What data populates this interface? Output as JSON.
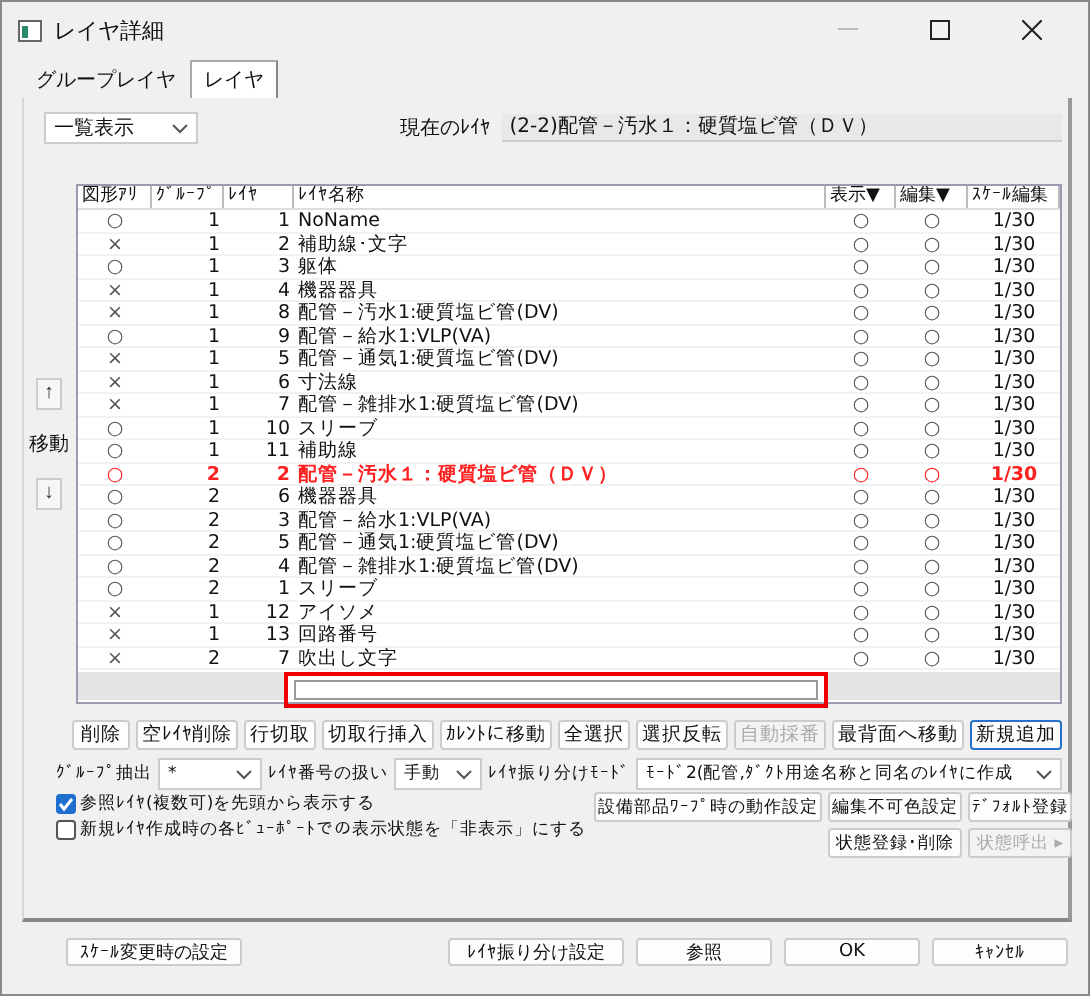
{
  "window": {
    "title": "レイヤ詳細"
  },
  "tabs": [
    {
      "label": "グループレイヤ",
      "selected": false
    },
    {
      "label": "レイヤ",
      "selected": true
    }
  ],
  "view_select": {
    "value": "一覧表示"
  },
  "current_layer": {
    "label": "現在のﾚｲﾔ",
    "value": "(2-2)配管－汚水１：硬質塩ビ管（ＤＶ）"
  },
  "move": {
    "label": "移動",
    "up": "↑",
    "down": "↓"
  },
  "table": {
    "columns": [
      "図形ｱﾘ",
      "ｸﾞﾙｰﾌﾟ",
      "ﾚｲﾔ",
      "ﾚｲﾔ名称",
      "表示▼",
      "編集▼",
      "ｽｹｰﾙ編集"
    ],
    "rows": [
      {
        "shape": "○",
        "group": "1",
        "layer": "1",
        "name": "NoName",
        "show": "○",
        "edit": "○",
        "scale": "1/30",
        "current": false
      },
      {
        "shape": "×",
        "group": "1",
        "layer": "2",
        "name": "補助線･文字",
        "show": "○",
        "edit": "○",
        "scale": "1/30",
        "current": false
      },
      {
        "shape": "○",
        "group": "1",
        "layer": "3",
        "name": "躯体",
        "show": "○",
        "edit": "○",
        "scale": "1/30",
        "current": false
      },
      {
        "shape": "×",
        "group": "1",
        "layer": "4",
        "name": "機器器具",
        "show": "○",
        "edit": "○",
        "scale": "1/30",
        "current": false
      },
      {
        "shape": "×",
        "group": "1",
        "layer": "8",
        "name": "配管－汚水1:硬質塩ビ管(DV)",
        "show": "○",
        "edit": "○",
        "scale": "1/30",
        "current": false
      },
      {
        "shape": "○",
        "group": "1",
        "layer": "9",
        "name": "配管－給水1:VLP(VA)",
        "show": "○",
        "edit": "○",
        "scale": "1/30",
        "current": false
      },
      {
        "shape": "×",
        "group": "1",
        "layer": "5",
        "name": "配管－通気1:硬質塩ビ管(DV)",
        "show": "○",
        "edit": "○",
        "scale": "1/30",
        "current": false
      },
      {
        "shape": "×",
        "group": "1",
        "layer": "6",
        "name": "寸法線",
        "show": "○",
        "edit": "○",
        "scale": "1/30",
        "current": false
      },
      {
        "shape": "×",
        "group": "1",
        "layer": "7",
        "name": "配管－雑排水1:硬質塩ビ管(DV)",
        "show": "○",
        "edit": "○",
        "scale": "1/30",
        "current": false
      },
      {
        "shape": "○",
        "group": "1",
        "layer": "10",
        "name": "スリーブ",
        "show": "○",
        "edit": "○",
        "scale": "1/30",
        "current": false
      },
      {
        "shape": "○",
        "group": "1",
        "layer": "11",
        "name": "補助線",
        "show": "○",
        "edit": "○",
        "scale": "1/30",
        "current": false
      },
      {
        "shape": "○",
        "group": "2",
        "layer": "2",
        "name": "配管－汚水１：硬質塩ビ管（ＤＶ）",
        "show": "○",
        "edit": "○",
        "scale": "1/30",
        "current": true
      },
      {
        "shape": "○",
        "group": "2",
        "layer": "6",
        "name": "機器器具",
        "show": "○",
        "edit": "○",
        "scale": "1/30",
        "current": false
      },
      {
        "shape": "○",
        "group": "2",
        "layer": "3",
        "name": "配管－給水1:VLP(VA)",
        "show": "○",
        "edit": "○",
        "scale": "1/30",
        "current": false
      },
      {
        "shape": "○",
        "group": "2",
        "layer": "5",
        "name": "配管－通気1:硬質塩ビ管(DV)",
        "show": "○",
        "edit": "○",
        "scale": "1/30",
        "current": false
      },
      {
        "shape": "○",
        "group": "2",
        "layer": "4",
        "name": "配管－雑排水1:硬質塩ビ管(DV)",
        "show": "○",
        "edit": "○",
        "scale": "1/30",
        "current": false
      },
      {
        "shape": "○",
        "group": "2",
        "layer": "1",
        "name": "スリーブ",
        "show": "○",
        "edit": "○",
        "scale": "1/30",
        "current": false
      },
      {
        "shape": "×",
        "group": "1",
        "layer": "12",
        "name": "アイソメ",
        "show": "○",
        "edit": "○",
        "scale": "1/30",
        "current": false
      },
      {
        "shape": "×",
        "group": "1",
        "layer": "13",
        "name": "回路番号",
        "show": "○",
        "edit": "○",
        "scale": "1/30",
        "current": false
      },
      {
        "shape": "×",
        "group": "2",
        "layer": "7",
        "name": "吹出し文字",
        "show": "○",
        "edit": "○",
        "scale": "1/30",
        "current": false
      }
    ]
  },
  "action_buttons": [
    {
      "label": "削除",
      "disabled": false,
      "focused": false
    },
    {
      "label": "空ﾚｲﾔ削除",
      "disabled": false,
      "focused": false
    },
    {
      "label": "行切取",
      "disabled": false,
      "focused": false
    },
    {
      "label": "切取行挿入",
      "disabled": false,
      "focused": false
    },
    {
      "label": "ｶﾚﾝﾄに移動",
      "disabled": false,
      "focused": false
    },
    {
      "label": "全選択",
      "disabled": false,
      "focused": false
    },
    {
      "label": "選択反転",
      "disabled": false,
      "focused": false
    },
    {
      "label": "自動採番",
      "disabled": true,
      "focused": false
    },
    {
      "label": "最背面へ移動",
      "disabled": false,
      "focused": false
    },
    {
      "label": "新規追加",
      "disabled": false,
      "focused": true
    }
  ],
  "options": [
    {
      "label": "ｸﾞﾙｰﾌﾟ抽出",
      "value": "*"
    },
    {
      "label": "ﾚｲﾔ番号の扱い",
      "value": "手動"
    },
    {
      "label": "ﾚｲﾔ振り分けﾓｰﾄﾞ",
      "value": "ﾓｰﾄﾞ2(配管,ﾀﾞｸﾄ用途名称と同名のﾚｲﾔに作成"
    }
  ],
  "checkboxes": [
    {
      "label": "参照ﾚｲﾔ(複数可)を先頭から表示する",
      "checked": true
    },
    {
      "label": "新規ﾚｲﾔ作成時の各ﾋﾞｭｰﾎﾟｰﾄでの表示状態を「非表示」にする",
      "checked": false
    }
  ],
  "side_buttons": [
    {
      "label": "設備部品ﾜｰﾌﾟ時の動作設定",
      "disabled": false
    },
    {
      "label": "編集不可色設定",
      "disabled": false
    },
    {
      "label": "ﾃﾞﾌｫﾙﾄ登録",
      "disabled": false
    },
    {
      "label": "状態登録･削除",
      "disabled": false
    },
    {
      "label": "状態呼出",
      "disabled": true,
      "arrow": "▸"
    }
  ],
  "footer_buttons": [
    "ｽｹｰﾙ変更時の設定",
    "ﾚｲﾔ振り分け設定",
    "参照",
    "OK",
    "ｷｬﾝｾﾙ"
  ]
}
